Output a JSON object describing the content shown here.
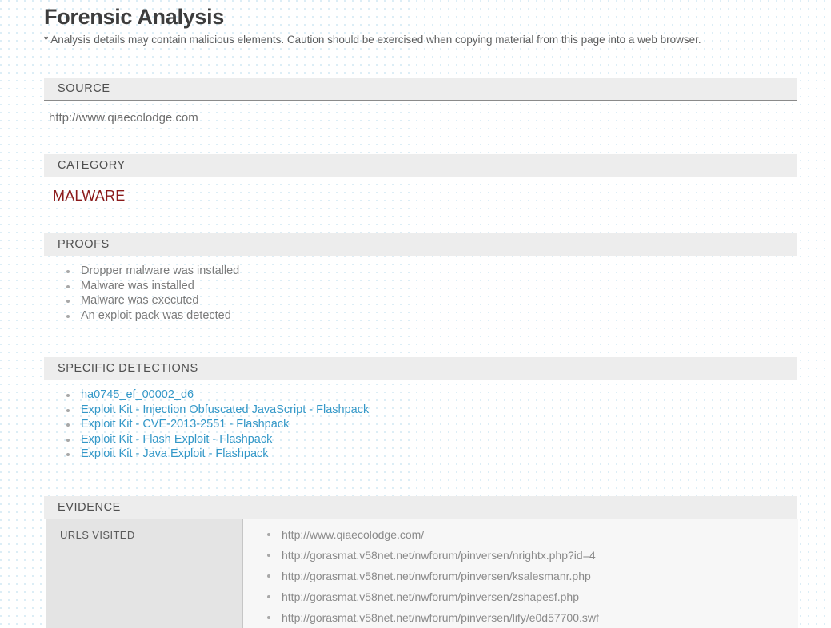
{
  "header": {
    "title": "Forensic Analysis",
    "note": "* Analysis details may contain malicious elements. Caution should be exercised when copying material from this page into a web browser."
  },
  "colors": {
    "link": "#3498c8",
    "category": "#8b1a1a",
    "section_header_bg": "#ededed",
    "evidence_label_bg": "#e4e4e4"
  },
  "sections": {
    "source": {
      "header": "SOURCE",
      "value": "http://www.qiaecolodge.com"
    },
    "category": {
      "header": "CATEGORY",
      "value": "MALWARE"
    },
    "proofs": {
      "header": "PROOFS",
      "items": [
        "Dropper malware was installed",
        "Malware was installed",
        "Malware was executed",
        "An exploit pack was detected"
      ]
    },
    "specific_detections": {
      "header": "SPECIFIC DETECTIONS",
      "items": [
        "ha0745_ef_00002_d6",
        "Exploit Kit - Injection Obfuscated JavaScript - Flashpack",
        "Exploit Kit - CVE-2013-2551 - Flashpack",
        "Exploit Kit - Flash Exploit - Flashpack",
        "Exploit Kit - Java Exploit - Flashpack"
      ]
    },
    "evidence": {
      "header": "EVIDENCE",
      "rows": [
        {
          "label": "URLS VISITED",
          "urls": [
            "http://www.qiaecolodge.com/",
            "http://gorasmat.v58net.net/nwforum/pinversen/nrightx.php?id=4",
            "http://gorasmat.v58net.net/nwforum/pinversen/ksalesmanr.php",
            "http://gorasmat.v58net.net/nwforum/pinversen/zshapesf.php",
            "http://gorasmat.v58net.net/nwforum/pinversen/lify/e0d57700.swf"
          ]
        }
      ]
    }
  }
}
